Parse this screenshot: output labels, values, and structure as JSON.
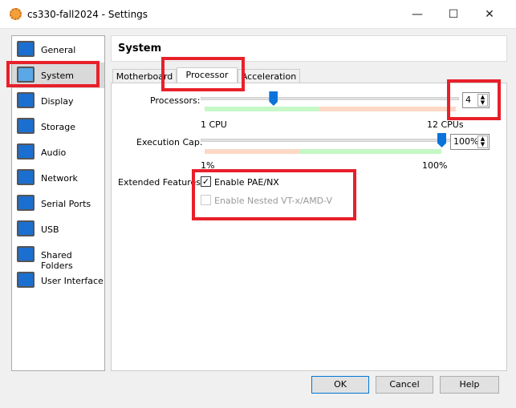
{
  "window": {
    "title": "cs330-fall2024 - Settings",
    "minimize": "—",
    "maximize": "☐",
    "close": "✕"
  },
  "sidebar": {
    "items": [
      {
        "label": "General",
        "icon": "general-monitor-icon"
      },
      {
        "label": "System",
        "icon": "system-chip-icon",
        "selected": true
      },
      {
        "label": "Display",
        "icon": "display-icon"
      },
      {
        "label": "Storage",
        "icon": "storage-icon"
      },
      {
        "label": "Audio",
        "icon": "audio-icon"
      },
      {
        "label": "Network",
        "icon": "network-icon"
      },
      {
        "label": "Serial Ports",
        "icon": "serial-ports-icon"
      },
      {
        "label": "USB",
        "icon": "usb-icon"
      },
      {
        "label": "Shared Folders",
        "icon": "shared-folders-icon"
      },
      {
        "label": "User Interface",
        "icon": "user-interface-icon"
      }
    ]
  },
  "header": {
    "title": "System"
  },
  "tabs": [
    {
      "label": "Motherboard"
    },
    {
      "label": "Processor",
      "active": true
    },
    {
      "label": "Acceleration"
    }
  ],
  "processor": {
    "label": "Processors:",
    "value": "4",
    "min_label": "1 CPU",
    "max_label": "12 CPUs",
    "min": 1,
    "max": 12,
    "current": 4,
    "recommended_max": 6
  },
  "execution_cap": {
    "label": "Execution Cap:",
    "value": "100%",
    "min_label": "1%",
    "max_label": "100%",
    "min": 1,
    "max": 100,
    "current": 100
  },
  "extended": {
    "label": "Extended Features:",
    "pae": {
      "label": "Enable PAE/NX",
      "checked": true
    },
    "nested": {
      "label": "Enable Nested VT-x/AMD-V",
      "checked": false,
      "disabled": true
    }
  },
  "buttons": {
    "ok": "OK",
    "cancel": "Cancel",
    "help": "Help"
  },
  "colors": {
    "annotation": "#e8202a",
    "thumb": "#0a74da",
    "green": "#c6f7c6",
    "orange": "#fdd8c6"
  }
}
